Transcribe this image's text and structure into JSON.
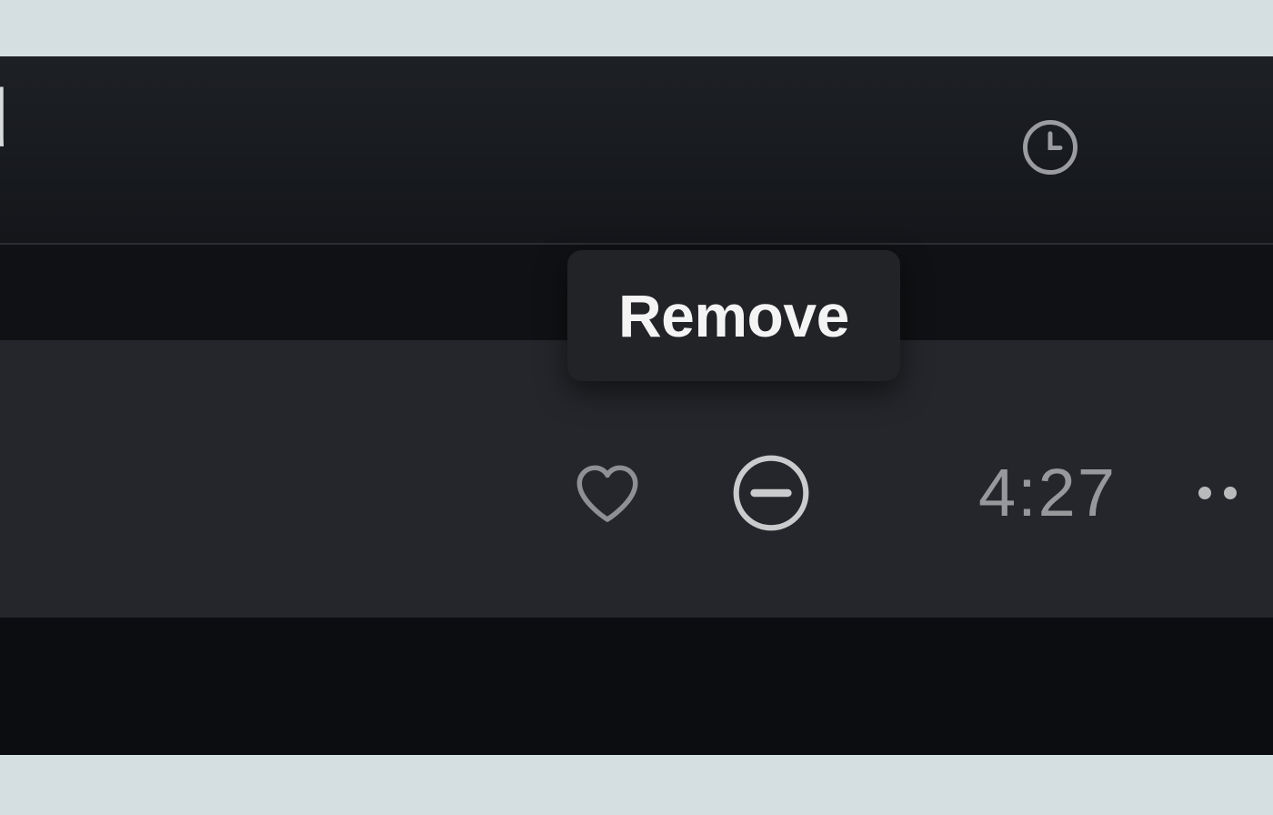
{
  "header": {
    "partial_text": "d"
  },
  "tooltip": {
    "text": "Remove"
  },
  "track": {
    "duration": "4:27"
  },
  "icons": {
    "clock": "clock-icon",
    "heart": "heart-icon",
    "remove": "remove-circle-icon",
    "more": "more-horizontal-icon"
  }
}
